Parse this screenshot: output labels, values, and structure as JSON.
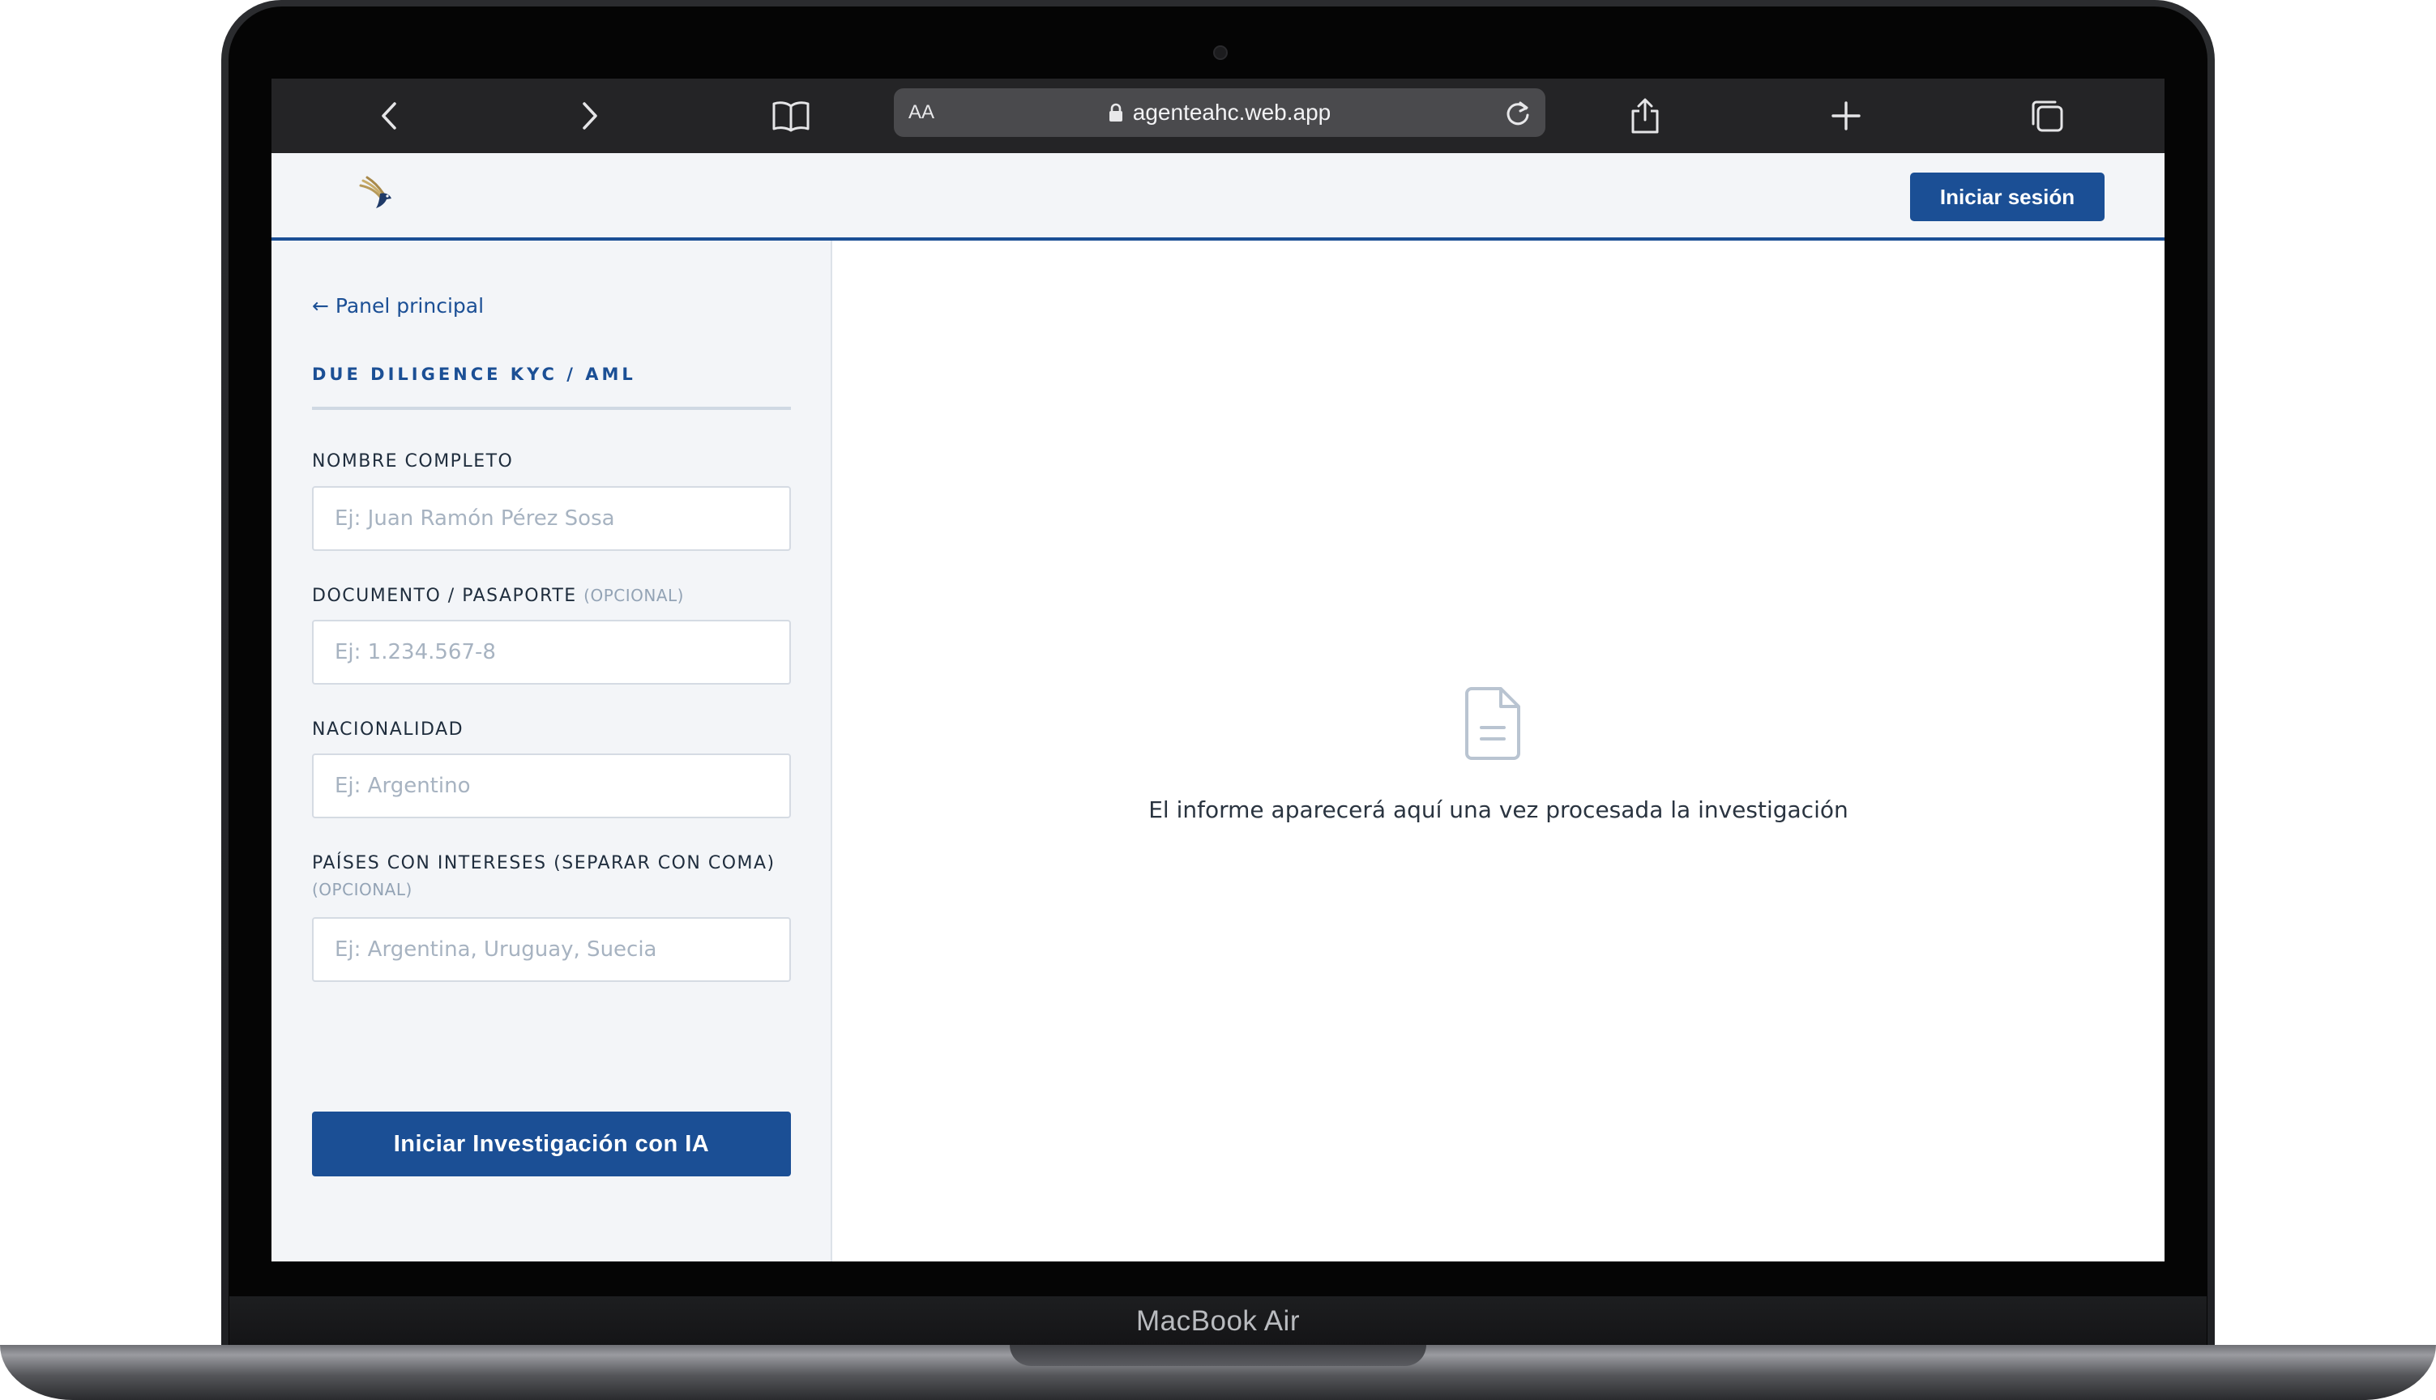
{
  "device": {
    "label": "MacBook Air"
  },
  "browser": {
    "address_bar": {
      "text_size_label": "AA",
      "url": "agenteahc.web.app"
    },
    "icons": {
      "back": "chevron-left-icon",
      "forward": "chevron-right-icon",
      "bookmarks": "book-icon",
      "lock": "lock-icon",
      "reload": "reload-icon",
      "share": "share-icon",
      "new_tab": "plus-icon",
      "tabs": "tabs-icon"
    }
  },
  "header": {
    "logo_icon": "eagle-logo-icon",
    "login_label": "Iniciar sesión"
  },
  "sidebar": {
    "back_link": "← Panel principal",
    "section_title": "DUE DILIGENCE KYC / AML",
    "fields": [
      {
        "label": "NOMBRE COMPLETO",
        "optional": "",
        "placeholder": "Ej: Juan Ramón Pérez Sosa",
        "value": ""
      },
      {
        "label": "DOCUMENTO / PASAPORTE",
        "optional": "(OPCIONAL)",
        "placeholder": "Ej: 1.234.567-8",
        "value": ""
      },
      {
        "label": "NACIONALIDAD",
        "optional": "",
        "placeholder": "Ej: Argentino",
        "value": ""
      },
      {
        "label": "PAÍSES CON INTERESES (SEPARAR CON COMA)",
        "optional": "(OPCIONAL)",
        "placeholder": "Ej: Argentina, Uruguay, Suecia",
        "value": ""
      }
    ],
    "submit_label": "Iniciar Investigación con IA"
  },
  "main": {
    "empty_icon": "document-icon",
    "empty_message": "El informe aparecerá aquí una vez procesada la investigación"
  },
  "colors": {
    "brand_blue": "#1b4f95",
    "sidebar_bg": "#f3f5f8",
    "toolbar_bg": "#242426"
  }
}
